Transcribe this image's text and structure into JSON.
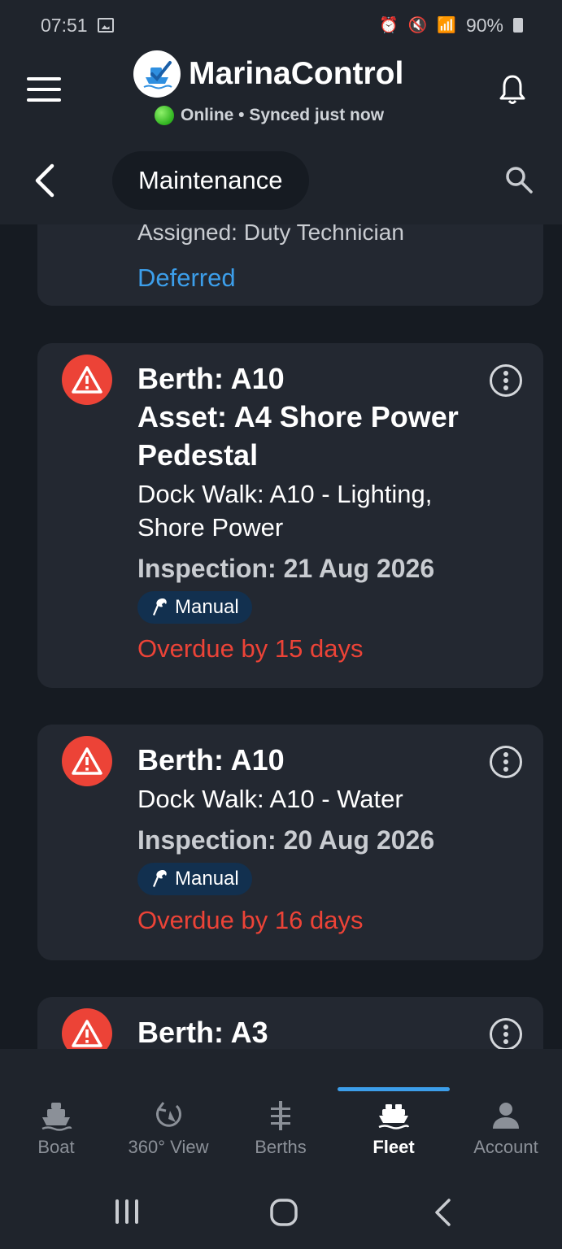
{
  "status_bar": {
    "time": "07:51",
    "battery": "90%"
  },
  "header": {
    "app_title": "MarinaControl",
    "sync_status": "Online • Synced just now",
    "section": "Maintenance"
  },
  "partial_card": {
    "assigned": "Assigned: Duty Technician",
    "status": "Deferred"
  },
  "cards": [
    {
      "berth": "Berth: A10",
      "asset": "Asset: A4 Shore Power Pedestal",
      "description": "Dock Walk: A10 - Lighting, Shore Power",
      "inspection": "Inspection: 21 Aug 2026",
      "badge": "Manual",
      "overdue": "Overdue by 15 days"
    },
    {
      "berth": "Berth: A10",
      "description": "Dock Walk: A10 - Water",
      "inspection": "Inspection: 20 Aug 2026",
      "badge": "Manual",
      "overdue": "Overdue by 16 days"
    },
    {
      "berth": "Berth: A3"
    }
  ],
  "bottom_nav": [
    {
      "label": "Boat",
      "icon": "boat-icon"
    },
    {
      "label": "360° View",
      "icon": "panorama-icon"
    },
    {
      "label": "Berths",
      "icon": "berths-icon"
    },
    {
      "label": "Fleet",
      "icon": "fleet-icon",
      "active": true
    },
    {
      "label": "Account",
      "icon": "account-icon"
    }
  ],
  "colors": {
    "accent": "#3c9eea",
    "alert": "#ec4337",
    "online": "#2fb31f",
    "background": "#161b22",
    "card": "#232831"
  }
}
